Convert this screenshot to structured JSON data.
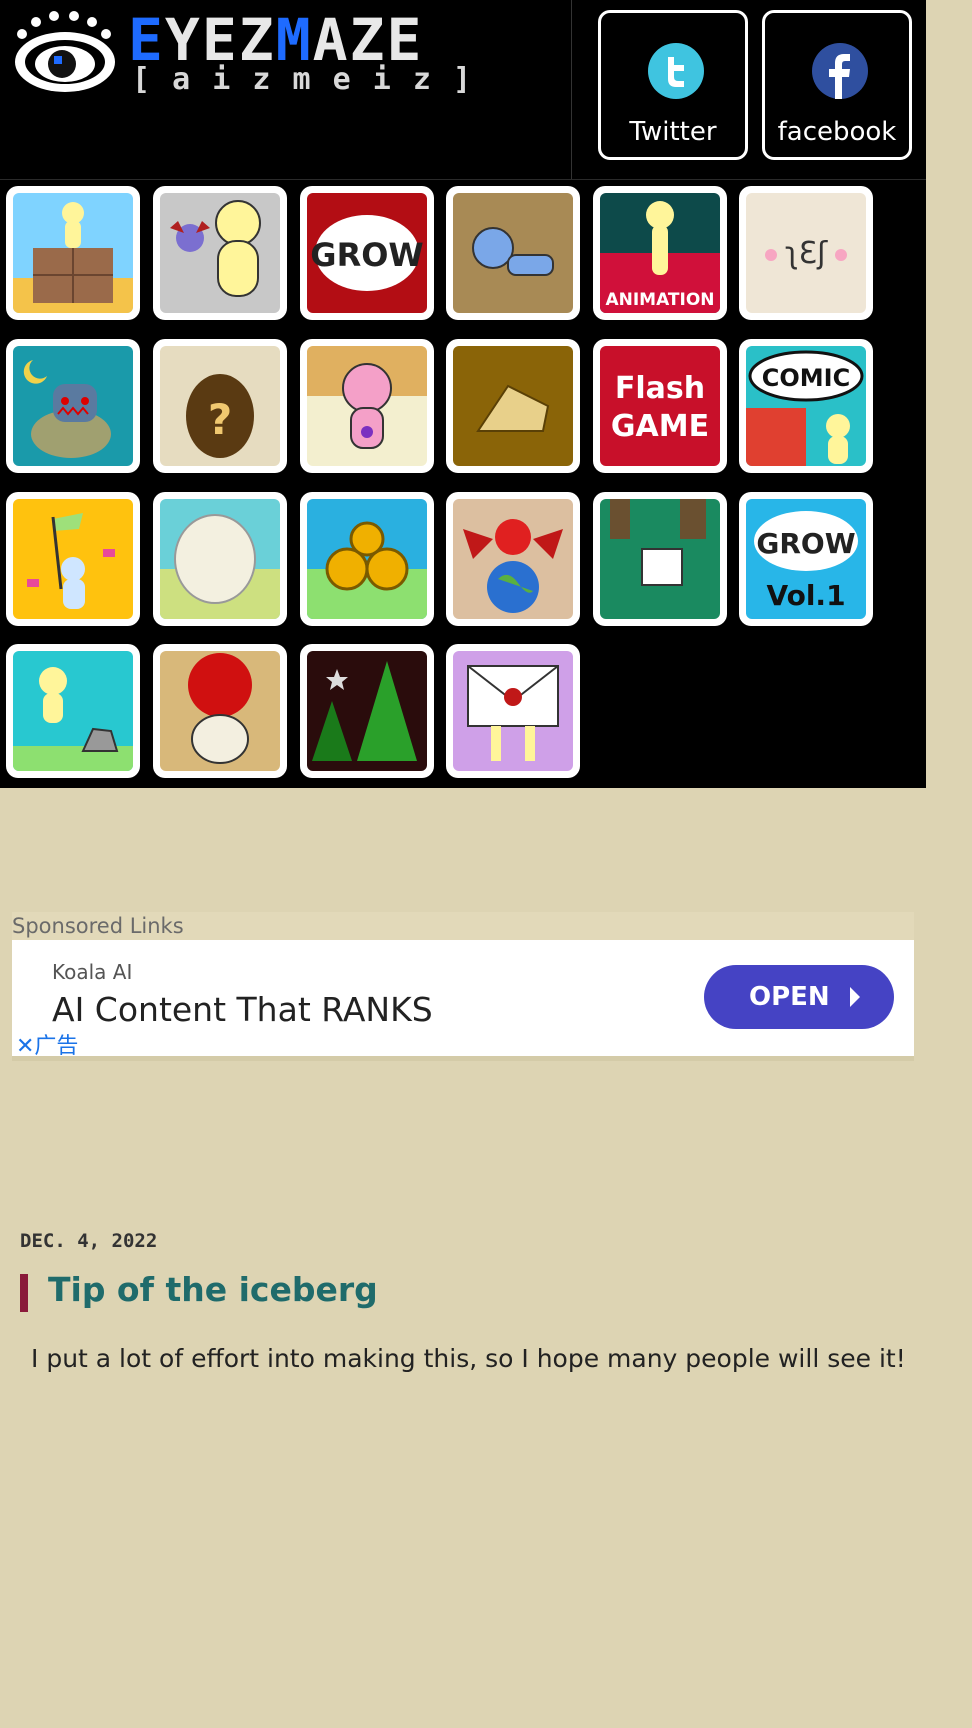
{
  "header": {
    "logo_text_a": "E",
    "logo_text_b": "YEZ",
    "logo_text_c": "M",
    "logo_text_d": "AZE",
    "logo_sub": "[ a i z m e i z ]",
    "twitter_label": "Twitter",
    "facebook_label": "facebook"
  },
  "tiles": {
    "grow_label": "GROW",
    "animation_label": "ANIMATION",
    "flash_line1": "Flash",
    "flash_line2": "GAME",
    "comic_label": "COMIC",
    "grow_vol_top": "GROW",
    "grow_vol_bottom": "Vol.1",
    "sticker_face": "ʅƐʃ"
  },
  "ad": {
    "sponsored_label": "Sponsored Links",
    "brand": "Koala AI",
    "headline": "AI Content That RANKS",
    "cta": "OPEN",
    "close_label": "✕广告"
  },
  "post": {
    "date": "DEC. 4, 2022",
    "title": "Tip of the iceberg",
    "body": "I put a lot of effort into making this, so I hope many people will see it!"
  },
  "colors": {
    "page_bg": "#ddd4b3",
    "logo_blue": "#1e6bff",
    "title_teal": "#1f6b6b",
    "title_accent": "#8a1a3a",
    "ad_button": "#4543c4",
    "twitter": "#3fc4e0",
    "facebook": "#2f4f9f"
  },
  "icons": [
    "eye-logo-icon",
    "twitter-icon",
    "facebook-icon"
  ]
}
